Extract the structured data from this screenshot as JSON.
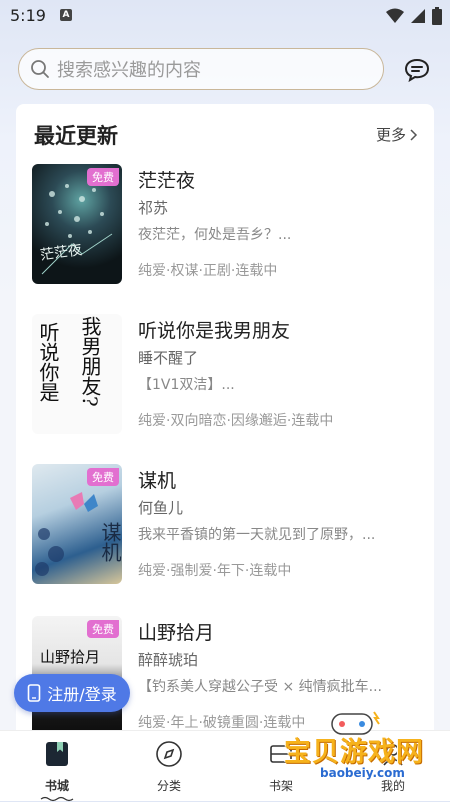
{
  "status_bar": {
    "time": "5:19",
    "notification_letter": "A"
  },
  "search": {
    "placeholder": "搜索感兴趣的内容"
  },
  "section": {
    "title": "最近更新",
    "more_label": "更多"
  },
  "books": [
    {
      "title": "茫茫夜",
      "author": "祁苏",
      "desc": "夜茫茫，何处是吾乡？...",
      "tags": "纯爱·权谋·正剧·连载中",
      "badge": "免费",
      "cover_text": "茫茫夜"
    },
    {
      "title": "听说你是我男朋友",
      "author": "睡不醒了",
      "desc": "【1V1双洁】...",
      "tags": "纯爱·双向暗恋·因缘邂逅·连载中",
      "badge": "",
      "cover_text_left": "听说你是",
      "cover_text_right": "我男朋友?"
    },
    {
      "title": "谋机",
      "author": "何鱼儿",
      "desc": "我来平香镇的第一天就见到了原野，...",
      "tags": "纯爱·强制爱·年下·连载中",
      "badge": "免费",
      "cover_text": "谋机"
    },
    {
      "title": "山野拾月",
      "author": "醉醉琥珀",
      "desc": "【钓系美人穿越公子受 × 纯情疯批车...",
      "tags": "纯爱·年上·破镜重圆·连载中",
      "badge": "免费",
      "cover_text": "山野拾月"
    }
  ],
  "fab": {
    "label": "注册/登录"
  },
  "nav": [
    {
      "label": "书城",
      "icon": "bookstore-icon",
      "active": true
    },
    {
      "label": "分类",
      "icon": "compass-icon",
      "active": false
    },
    {
      "label": "书架",
      "icon": "bookshelf-icon",
      "active": false
    },
    {
      "label": "我的",
      "icon": "profile-icon",
      "active": false
    }
  ],
  "watermark": {
    "text": "宝贝游戏网",
    "url": "baobeiy.com"
  },
  "colors": {
    "accent": "#4f79e6",
    "badge": "#e26fd0",
    "search_border": "#c9b79a"
  }
}
